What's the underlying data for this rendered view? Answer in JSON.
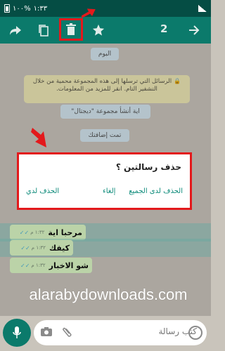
{
  "status_bar": {
    "time": "١:٣٣",
    "battery_percent": "%١٠٠"
  },
  "toolbar": {
    "selected_count": "2",
    "icons": [
      "arrow-back-icon",
      "star-icon",
      "delete-icon",
      "copy-icon",
      "forward-icon"
    ]
  },
  "chat": {
    "date_label": "اليوم",
    "encryption_notice": "الرسائل التي ترسلها إلى هذه المجموعة محمية من خلال التشفير التام. انقر للمزيد من المعلومات.",
    "system_created": "اية أنشأ مجموعة \"ديجتال\"",
    "system_added": "تمت إضافتك",
    "messages": [
      {
        "text": "مرحبا اية",
        "time": "١:٣٢ م"
      },
      {
        "text": "كيفك",
        "time": "١:٣٢ م"
      },
      {
        "text": "شو الاخبار",
        "time": "١:٣٢ م"
      }
    ]
  },
  "dialog": {
    "title": "حذف رسالتين ؟",
    "delete_all": "الحذف لدى الجميع",
    "cancel": "إلغاء",
    "delete_for_me": "الحذف لدي"
  },
  "input": {
    "placeholder": "كتب رسالة"
  },
  "watermark": "alarabydownloads.com",
  "colors": {
    "header": "#0b7a6b",
    "status": "#054d44",
    "highlight": "#e3191c",
    "accent": "#0b8a79"
  }
}
